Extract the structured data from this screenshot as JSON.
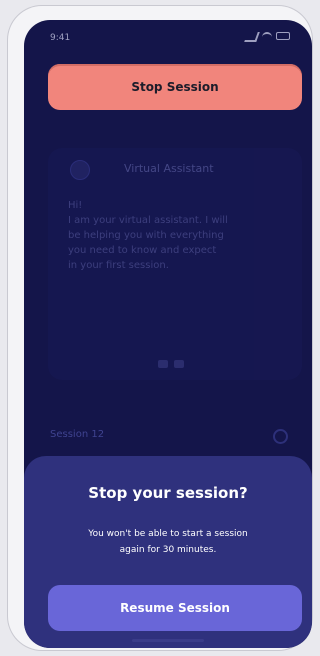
{
  "status": {
    "time": "9:41"
  },
  "actions": {
    "stop_session": "Stop Session",
    "resume_session": "Resume Session"
  },
  "chat": {
    "assistant_name": "Virtual Assistant",
    "message_lines": [
      "Hi!",
      "I am your virtual assistant. I will",
      "be helping you with everything",
      "you need to know and expect",
      "in your first session."
    ]
  },
  "session": {
    "label": "Session 12"
  },
  "dialog": {
    "title": "Stop your session?",
    "body_line_1": "You won't be able to start a session",
    "body_line_2": "again for 30 minutes."
  },
  "colors": {
    "background": "#14154a",
    "stop_button": "#f1857c",
    "sheet": "#2f317d",
    "resume_button": "#6966d8"
  },
  "icons": {
    "status": [
      "signal-icon",
      "wifi-icon",
      "battery-icon"
    ],
    "assistant": "assistant-avatar-icon",
    "settings": "gear-icon"
  }
}
